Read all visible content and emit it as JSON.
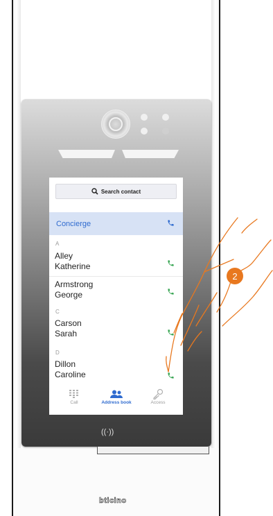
{
  "screen": {
    "search_label": "Search contact",
    "concierge": {
      "label": "Concierge"
    },
    "sections": [
      {
        "letter": "A"
      },
      {
        "letter": "C"
      },
      {
        "letter": "D"
      }
    ],
    "contacts": [
      {
        "first": "Alley",
        "second": "Katherine"
      },
      {
        "first": "Armstrong",
        "second": "George"
      },
      {
        "first": "Carson",
        "second": "Sarah"
      },
      {
        "first": "Dillon",
        "second": "Caroline"
      }
    ],
    "nav": {
      "call": "Call",
      "address_book": "Address book",
      "access": "Access"
    }
  },
  "nfc_label": "((·))",
  "step_badge": "2",
  "brand_logo": "bticino",
  "colors": {
    "accent_blue": "#2f6bcf",
    "phone_green": "#3aa655",
    "badge_orange": "#e8781f",
    "highlight_row": "#d7e2f5"
  }
}
